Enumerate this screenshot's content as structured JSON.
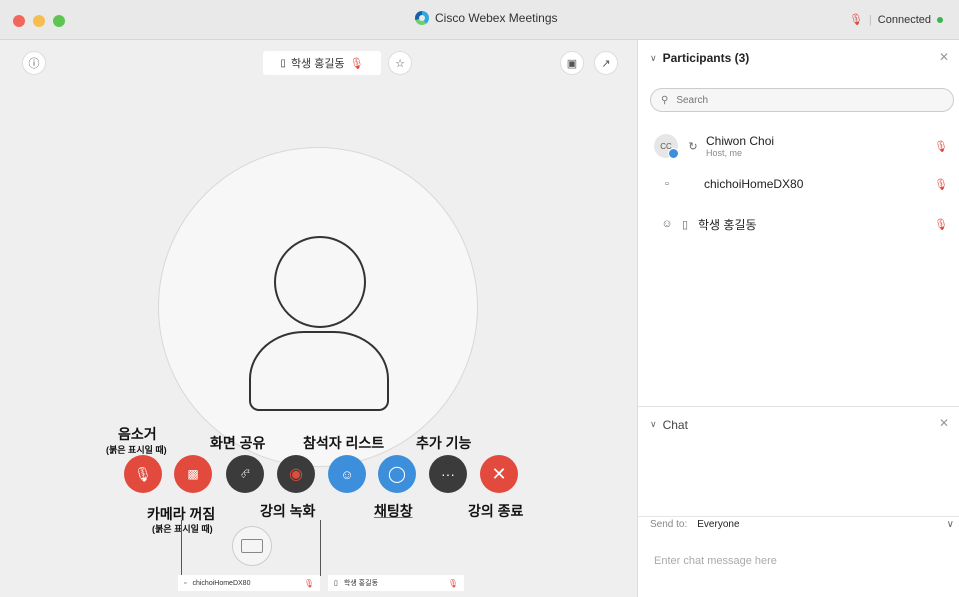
{
  "window": {
    "title": "Cisco Webex Meetings",
    "status": "Connected",
    "status_color": "#39b54a"
  },
  "stage": {
    "active_speaker": "학생 홍길동",
    "self_video_label": "chichoiHomeDX80",
    "remote_video_label": "학생 홍길동"
  },
  "controls": [
    {
      "name": "mute",
      "icon": "microphone-icon",
      "color": "#e14a3c"
    },
    {
      "name": "camera",
      "icon": "video-off-icon",
      "color": "#e14a3c"
    },
    {
      "name": "share",
      "icon": "share-screen-icon",
      "color": "#3b3b3b"
    },
    {
      "name": "record",
      "icon": "record-icon",
      "color": "#3b3b3b"
    },
    {
      "name": "participants",
      "icon": "participants-icon",
      "color": "#3d8fdb"
    },
    {
      "name": "chat",
      "icon": "chat-icon",
      "color": "#3d8fdb"
    },
    {
      "name": "more",
      "icon": "more-icon",
      "color": "#3b3b3b"
    },
    {
      "name": "end",
      "icon": "close-icon",
      "color": "#e14a3c"
    }
  ],
  "annotations": {
    "mute": "음소거",
    "mute_note": "(붉은 표시일 때)",
    "share": "화면 공유",
    "participants": "참석자 리스트",
    "more": "추가 기능",
    "camera": "카메라 꺼짐",
    "camera_note": "(붉은 표시일 때)",
    "record": "강의 녹화",
    "chat": "채팅창",
    "end": "강의 종료"
  },
  "participants_panel": {
    "title": "Participants (3)",
    "search_placeholder": "Search",
    "items": [
      {
        "name": "Chiwon Choi",
        "subtitle": "Host, me",
        "avatar": "CC"
      },
      {
        "name": "chichoiHomeDX80",
        "subtitle": ""
      },
      {
        "name": "학생 홍길동",
        "subtitle": ""
      }
    ]
  },
  "chat_panel": {
    "title": "Chat",
    "send_to_label": "Send to:",
    "send_to_value": "Everyone",
    "input_placeholder": "Enter chat message here"
  }
}
